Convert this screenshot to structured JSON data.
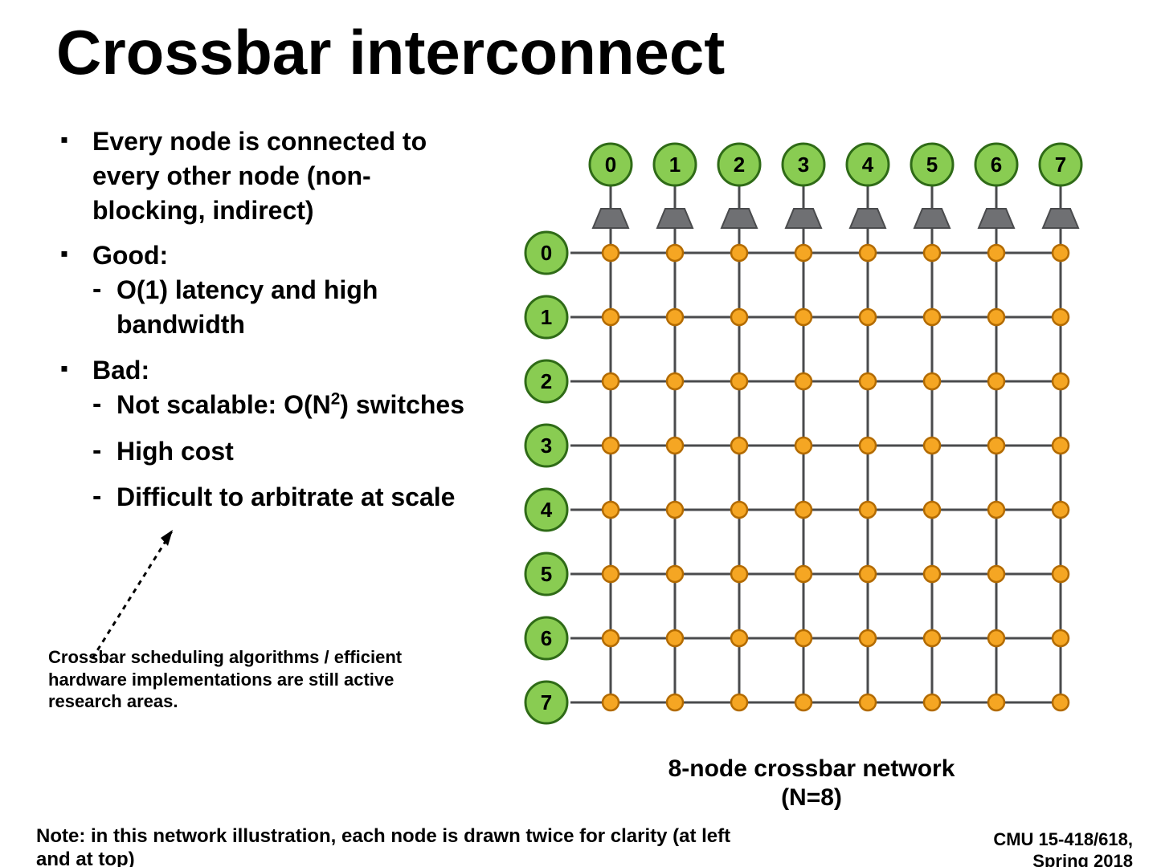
{
  "title": "Crossbar interconnect",
  "bullets": {
    "b1": "Every node is connected to every other node (non-blocking, indirect)",
    "b2": "Good:",
    "b2s1": "O(1) latency and high bandwidth",
    "b3": "Bad:",
    "b3s1_pre": "Not scalable: O(N",
    "b3s1_sup": "2",
    "b3s1_post": ") switches",
    "b3s2": "High cost",
    "b3s3": "Difficult to arbitrate at scale"
  },
  "footnote1": "Crossbar scheduling algorithms / efficient hardware implementations are still active research areas.",
  "footnote2": "Note: in this network illustration, each node is drawn twice for clarity (at left and at top)",
  "caption_l1": "8-node crossbar network",
  "caption_l2": "(N=8)",
  "course_l1": "CMU 15-418/618,",
  "course_l2": "Spring 2018",
  "diagram": {
    "top_labels": [
      "0",
      "1",
      "2",
      "3",
      "4",
      "5",
      "6",
      "7"
    ],
    "left_labels": [
      "0",
      "1",
      "2",
      "3",
      "4",
      "5",
      "6",
      "7"
    ]
  },
  "colors": {
    "node_fill": "#89cc52",
    "node_stroke": "#2f6b17",
    "arbiter_fill": "#6f7073",
    "arbiter_stroke": "#4a4b4d",
    "switch_fill": "#f5a623",
    "switch_stroke": "#b36b00",
    "wire": "#4a4b4d"
  }
}
